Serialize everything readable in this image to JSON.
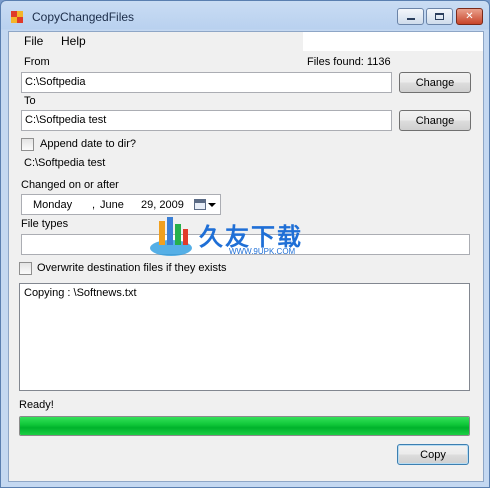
{
  "window": {
    "title": "CopyChangedFiles"
  },
  "menu": {
    "file": "File",
    "help": "Help"
  },
  "files_found": "Files found: 1136",
  "from": {
    "label": "From",
    "value": "C:\\Softpedia",
    "button": "Change"
  },
  "to": {
    "label": "To",
    "value": "C:\\Softpedia test",
    "button": "Change"
  },
  "append_date": {
    "label": "Append date to dir?",
    "checked": false,
    "preview": "C:\\Softpedia test"
  },
  "changed_on": {
    "label": "Changed on or after",
    "weekday": "Monday",
    "sep": ",",
    "month": "June",
    "day_year": "29, 2009"
  },
  "file_types": {
    "label": "File types",
    "value": ""
  },
  "overwrite": {
    "label": "Overwrite destination files if they exists",
    "checked": false
  },
  "log": {
    "text": "Copying : \\Softnews.txt"
  },
  "status": {
    "text": "Ready!",
    "progress": 1.0,
    "color": "#11c93a"
  },
  "copy_button": "Copy",
  "watermark": {
    "text": "久友下载",
    "sub": "WWW.9UPK.COM"
  },
  "icons": [
    "app-icon",
    "minimize-icon",
    "maximize-icon",
    "close-icon",
    "calendar-icon",
    "chevron-down-icon",
    "watermark-logo-icon"
  ]
}
